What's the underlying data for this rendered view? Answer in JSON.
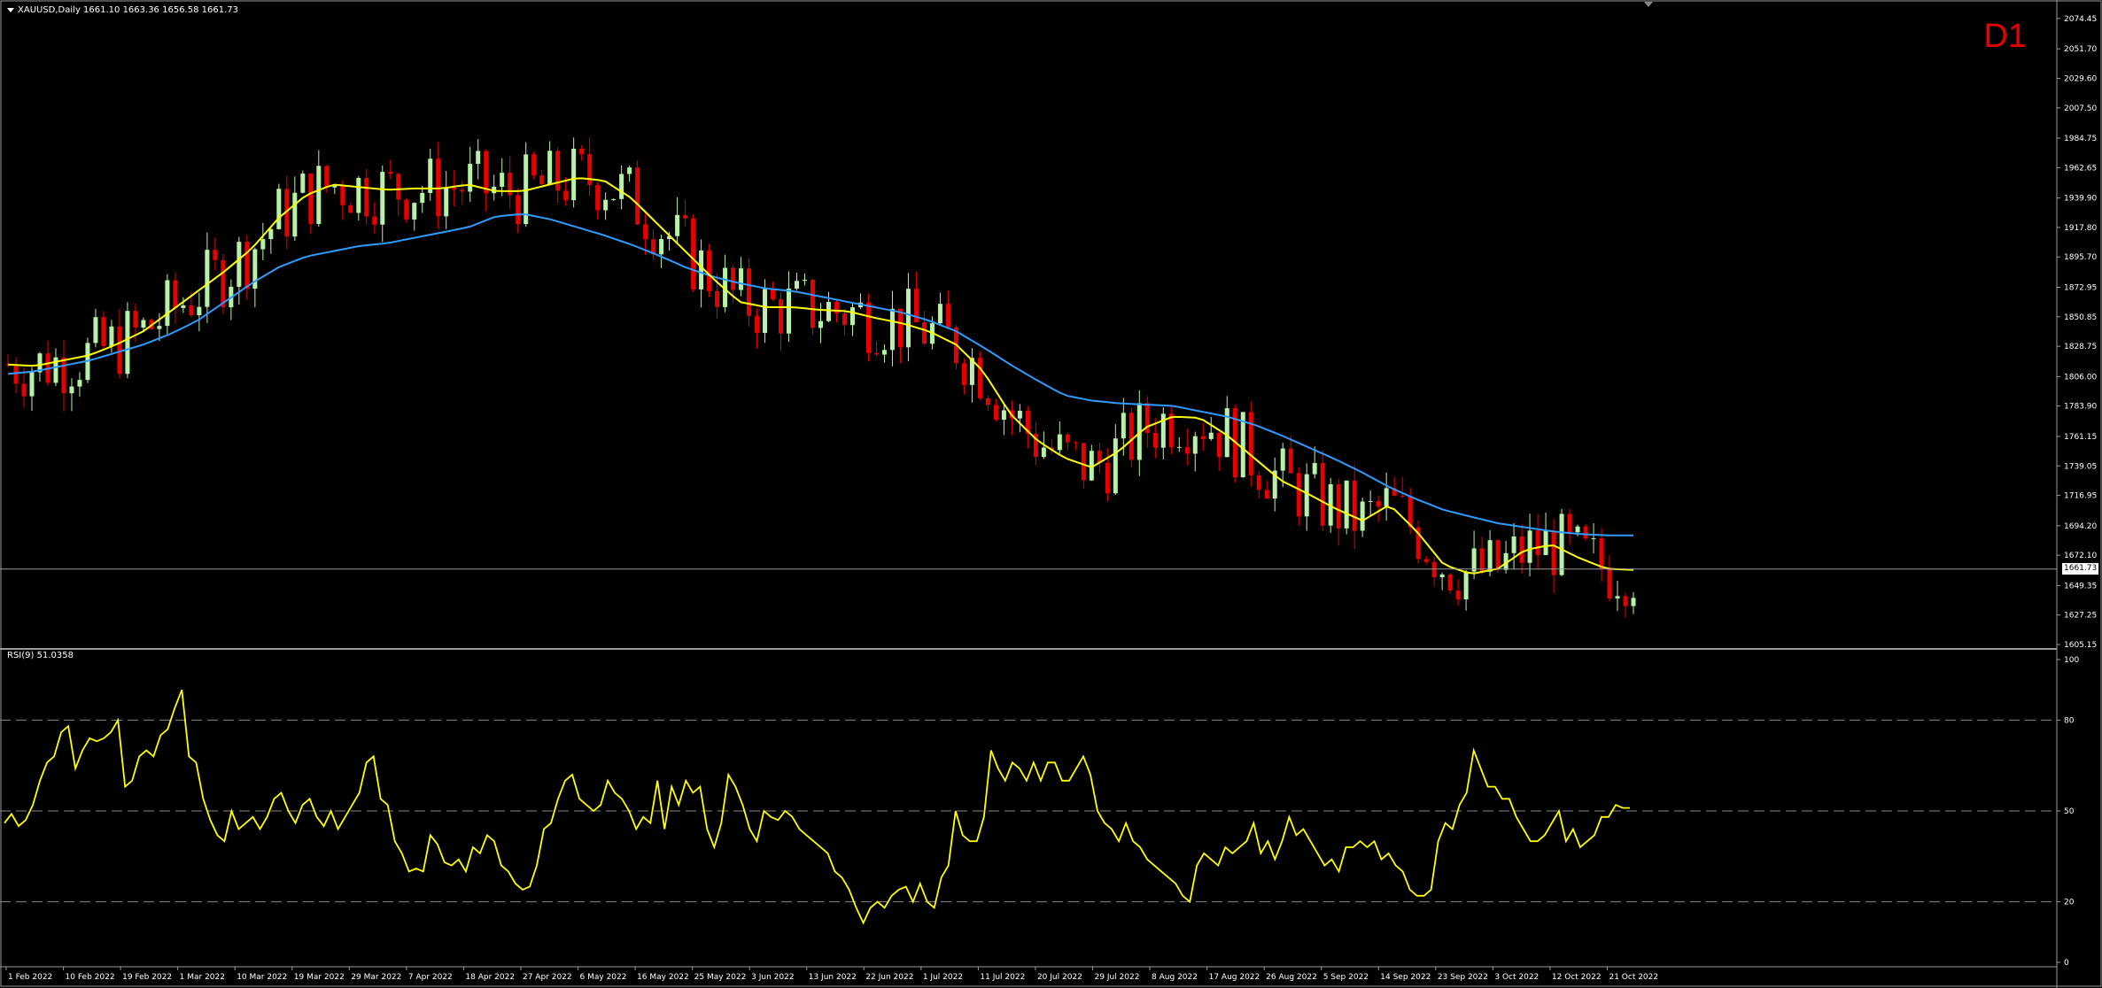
{
  "window": {
    "symbol_line": "XAUUSD,Daily  1661.10 1663.36 1656.58 1661.73",
    "timeframe_badge": "D1",
    "current_price_tag": "1661.73"
  },
  "rsi_panel": {
    "label": "RSI(9) 51.0358"
  },
  "colors": {
    "background": "#000000",
    "bull_candle": "#b8f2a8",
    "bear_candle": "#e60000",
    "ma_fast": "#ffff00",
    "ma_slow": "#2e9bff",
    "rsi_line": "#ffff00",
    "axis_text": "#ffffff",
    "grid_dash": "#888888",
    "badge": "#e60000"
  },
  "chart_data": [
    {
      "type": "candlestick",
      "title": "XAUUSD,Daily",
      "price_ticks": [
        "2074.45",
        "2051.70",
        "2029.60",
        "2007.50",
        "1984.75",
        "1962.65",
        "1939.90",
        "1917.80",
        "1895.70",
        "1872.95",
        "1850.85",
        "1828.75",
        "1806.00",
        "1783.90",
        "1761.15",
        "1739.05",
        "1716.95",
        "1694.20",
        "1672.10",
        "1649.35",
        "1627.25",
        "1605.15"
      ],
      "ylim": [
        1605.15,
        2085
      ],
      "date_labels": [
        "1 Feb 2022",
        "10 Feb 2022",
        "19 Feb 2022",
        "1 Mar 2022",
        "10 Mar 2022",
        "19 Mar 2022",
        "29 Mar 2022",
        "7 Apr 2022",
        "18 Apr 2022",
        "27 Apr 2022",
        "6 May 2022",
        "16 May 2022",
        "25 May 2022",
        "3 Jun 2022",
        "13 Jun 2022",
        "22 Jun 2022",
        "1 Jul 2022",
        "11 Jul 2022",
        "20 Jul 2022",
        "29 Jul 2022",
        "8 Aug 2022",
        "17 Aug 2022",
        "26 Aug 2022",
        "5 Sep 2022",
        "14 Sep 2022",
        "23 Sep 2022",
        "3 Oct 2022",
        "12 Oct 2022",
        "21 Oct 2022"
      ],
      "last_price": 1661.73,
      "series": [
        {
          "name": "MA fast",
          "values": [
            1815,
            1814,
            1818,
            1822,
            1830,
            1840,
            1855,
            1870,
            1885,
            1902,
            1925,
            1942,
            1950,
            1948,
            1946,
            1947,
            1947,
            1950,
            1945,
            1945,
            1950,
            1955,
            1953,
            1940,
            1920,
            1900,
            1880,
            1862,
            1858,
            1858,
            1856,
            1855,
            1850,
            1846,
            1840,
            1830,
            1810,
            1778,
            1758,
            1745,
            1738,
            1750,
            1768,
            1776,
            1775,
            1762,
            1745,
            1728,
            1718,
            1707,
            1698,
            1710,
            1690,
            1665,
            1658,
            1662,
            1676,
            1680,
            1670,
            1662,
            1661
          ]
        },
        {
          "name": "MA slow",
          "values": [
            1808,
            1810,
            1814,
            1818,
            1824,
            1830,
            1838,
            1848,
            1862,
            1876,
            1888,
            1896,
            1900,
            1904,
            1906,
            1910,
            1914,
            1918,
            1926,
            1928,
            1924,
            1918,
            1912,
            1905,
            1897,
            1888,
            1881,
            1876,
            1872,
            1870,
            1866,
            1862,
            1858,
            1854,
            1848,
            1840,
            1828,
            1815,
            1803,
            1792,
            1788,
            1786,
            1785,
            1784,
            1780,
            1776,
            1770,
            1762,
            1753,
            1744,
            1734,
            1723,
            1714,
            1706,
            1701,
            1696,
            1693,
            1690,
            1688,
            1687,
            1687
          ]
        }
      ]
    },
    {
      "type": "line",
      "title": "RSI(9) 51.0358",
      "ylim": [
        0,
        100
      ],
      "levels": [
        20,
        50,
        80
      ],
      "yticks": [
        "100",
        "80",
        "50",
        "20",
        "0"
      ],
      "series": [
        {
          "name": "RSI(9)",
          "values": [
            46,
            49,
            45,
            47,
            52,
            60,
            66,
            68,
            76,
            78,
            64,
            70,
            74,
            73,
            74,
            76,
            80,
            58,
            60,
            68,
            70,
            68,
            75,
            77,
            84,
            90,
            68,
            66,
            54,
            47,
            42,
            40,
            50,
            44,
            46,
            48,
            44,
            48,
            54,
            56,
            50,
            46,
            52,
            54,
            48,
            45,
            50,
            44,
            48,
            52,
            56,
            66,
            68,
            54,
            52,
            40,
            36,
            30,
            31,
            30,
            42,
            39,
            33,
            32,
            34,
            30,
            38,
            36,
            42,
            40,
            32,
            30,
            26,
            24,
            25,
            32,
            44,
            46,
            54,
            60,
            62,
            54,
            52,
            50,
            52,
            60,
            56,
            54,
            50,
            44,
            48,
            46,
            60,
            44,
            58,
            52,
            60,
            56,
            58,
            44,
            38,
            46,
            62,
            58,
            52,
            44,
            40,
            50,
            48,
            47,
            50,
            48,
            44,
            42,
            40,
            38,
            36,
            30,
            28,
            24,
            18,
            13,
            18,
            20,
            18,
            22,
            24,
            25,
            20,
            26,
            20,
            18,
            28,
            32,
            50,
            42,
            40,
            40,
            48,
            70,
            64,
            60,
            66,
            64,
            60,
            66,
            60,
            66,
            66,
            60,
            60,
            64,
            68,
            62,
            50,
            46,
            44,
            40,
            46,
            40,
            38,
            34,
            32,
            30,
            28,
            26,
            22,
            20,
            32,
            36,
            34,
            32,
            38,
            36,
            38,
            40,
            46,
            36,
            40,
            34,
            40,
            48,
            42,
            44,
            40,
            36,
            32,
            34,
            30,
            38,
            38,
            40,
            38,
            40,
            34,
            36,
            32,
            30,
            24,
            22,
            22,
            24,
            40,
            46,
            44,
            52,
            56,
            70,
            64,
            58,
            58,
            54,
            54,
            48,
            44,
            40,
            40,
            42,
            46,
            50,
            40,
            44,
            38,
            40,
            42,
            48,
            48,
            52,
            51,
            51
          ]
        }
      ]
    }
  ]
}
